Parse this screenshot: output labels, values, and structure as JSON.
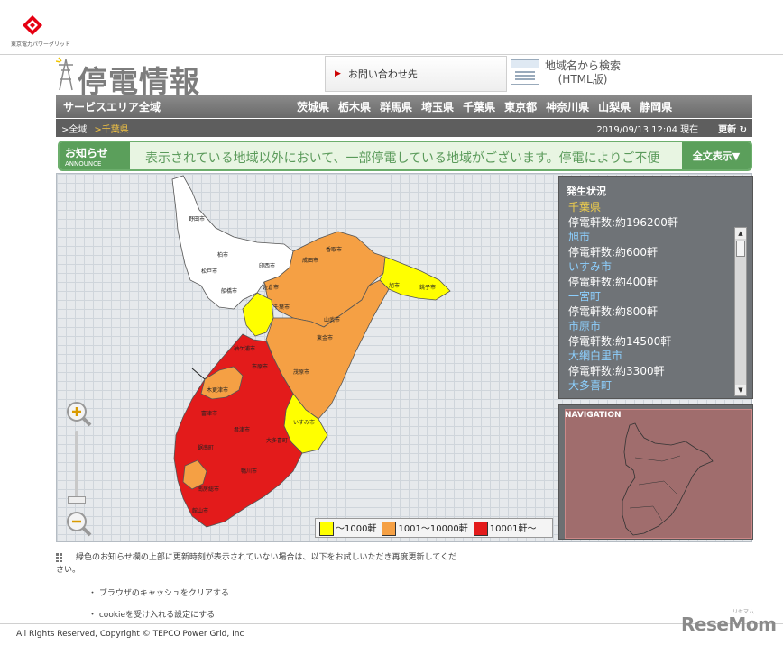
{
  "company": {
    "name": "東京電力パワーグリッド"
  },
  "header": {
    "title": "停電情報",
    "contact_label": "お問い合わせ先",
    "search_label_line1": "地域名から検索",
    "search_label_line2": "(HTML版)"
  },
  "nav": {
    "all_area": "サービスエリア全域",
    "prefectures": [
      "茨城県",
      "栃木県",
      "群馬県",
      "埼玉県",
      "千葉県",
      "東京都",
      "神奈川県",
      "山梨県",
      "静岡県"
    ]
  },
  "breadcrumb": {
    "root": ">全域",
    "current": ">千葉県",
    "timestamp": "2019/09/13 12:04 現在",
    "refresh": "更新"
  },
  "announce": {
    "label": "お知らせ",
    "label_en": "ANNOUNCE",
    "text": "表示されている地域以外において、一部停電している地域がございます。停電によりご不便",
    "button": "全文表示▼"
  },
  "status_panel": {
    "title": "発生状況",
    "prefecture": "千葉県",
    "prefecture_count": "停電軒数:約196200軒",
    "entries": [
      {
        "name": "旭市",
        "count": "停電軒数:約600軒"
      },
      {
        "name": "いすみ市",
        "count": "停電軒数:約400軒"
      },
      {
        "name": "一宮町",
        "count": "停電軒数:約800軒"
      },
      {
        "name": "市原市",
        "count": "停電軒数:約14500軒"
      },
      {
        "name": "大網白里市",
        "count": "停電軒数:約3300軒"
      },
      {
        "name": "大多喜町",
        "count": ""
      }
    ]
  },
  "navigation_panel": {
    "title": "NAVIGATION"
  },
  "legend": {
    "items": [
      {
        "label": "〜1000軒",
        "color": "#ffff00"
      },
      {
        "label": "1001〜10000軒",
        "color": "#f5a044"
      },
      {
        "label": "10001軒〜",
        "color": "#e31b1b"
      }
    ]
  },
  "map_labels": {
    "nodamachi": "野田市",
    "kashiwa": "柏市",
    "matsudo": "松戸市",
    "inzai": "印西市",
    "narita": "成田市",
    "katori": "香取市",
    "sakura": "佐倉市",
    "funabashi": "船橋市",
    "chiba": "千葉市",
    "sanmu": "山武市",
    "tougane": "東金市",
    "ichihara": "市原市",
    "kisarazu": "木更津市",
    "futtsu": "富津市",
    "kimitsu": "君津市",
    "kyonan": "鋸南町",
    "minamiboso": "南房総市",
    "tateyama": "館山市",
    "kamogawa": "鴨川市",
    "otaki": "大多喜町",
    "isumi": "いすみ市",
    "mobara": "茂原市",
    "choshi": "銚子市",
    "asahi": "旭市",
    "sodegaura": "袖ケ浦市"
  },
  "notice": {
    "line1": "緑色のお知らせ欄の上部に更新時刻が表示されていない場合は、以下をお試しいただき再度更新してくだ",
    "line2": "さい。",
    "bullet1": "・ ブラウザのキャッシュをクリアする",
    "bullet2": "・ cookieを受け入れる設定にする"
  },
  "footer": {
    "copyright": "All Rights Reserved, Copyright © TEPCO Power Grid, Inc",
    "watermark": "ReseMom",
    "watermark_small": "リセマム"
  }
}
